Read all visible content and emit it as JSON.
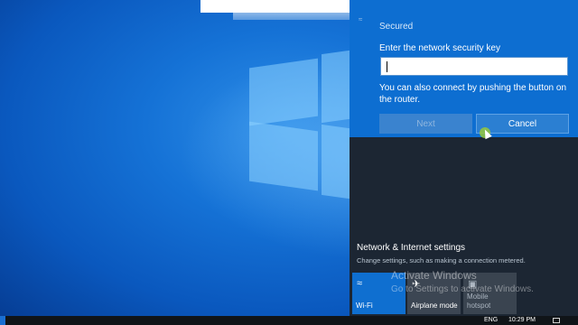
{
  "wifi_panel": {
    "status": "Secured",
    "key_label": "Enter the network security key",
    "key_value": "",
    "help_text": "You can also connect by pushing the button on the router.",
    "next_label": "Next",
    "cancel_label": "Cancel"
  },
  "network_settings": {
    "title": "Network & Internet settings",
    "description": "Change settings, such as making a connection metered."
  },
  "quick_actions": [
    {
      "label": "Wi-Fi",
      "icon": "wifi-icon",
      "active": true
    },
    {
      "label": "Airplane mode",
      "icon": "airplane-icon",
      "active": false
    },
    {
      "label": "Mobile hotspot",
      "icon": "hotspot-icon",
      "active": false
    }
  ],
  "watermark": {
    "title": "Activate Windows",
    "subtitle": "Go to Settings to activate Windows."
  },
  "taskbar": {
    "language": "ENG",
    "time": "10:29 PM"
  },
  "colors": {
    "accent": "#0d6ed1",
    "flyout_bg": "#1c2633",
    "desktop": "#1572d6"
  }
}
